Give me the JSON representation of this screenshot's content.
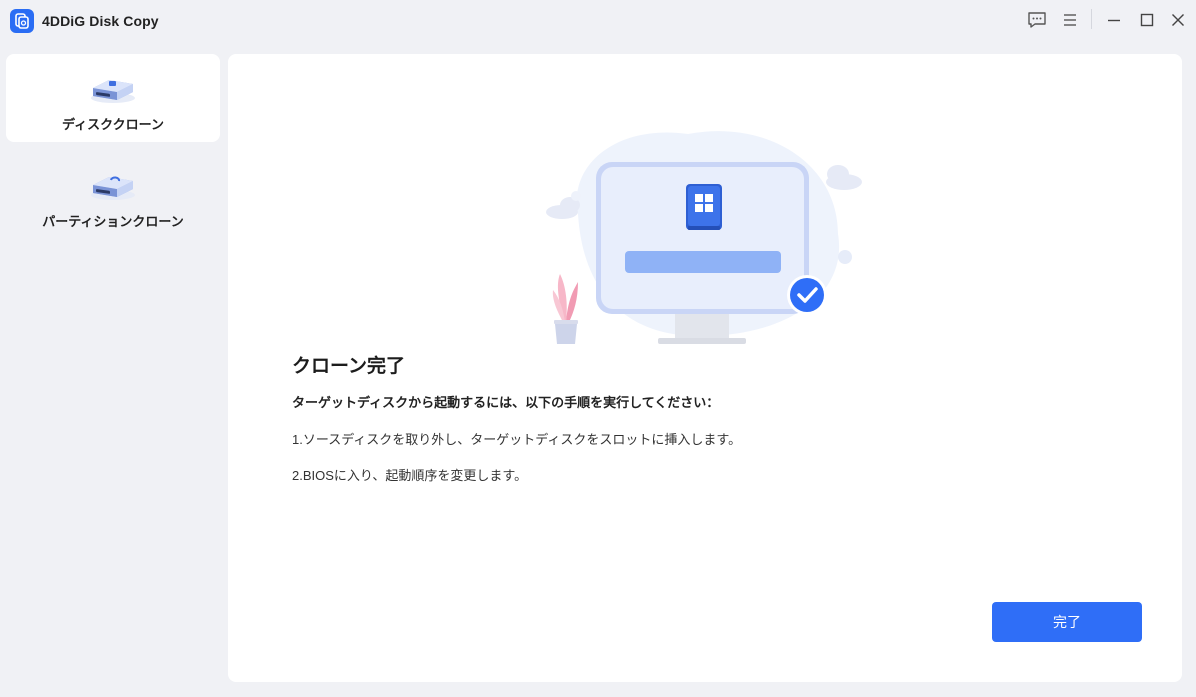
{
  "app": {
    "title": "4DDiG Disk Copy",
    "accent": "#2f6ef7"
  },
  "titlebar": {
    "icons": [
      "feedback-icon",
      "menu-icon",
      "minimize-icon",
      "maximize-icon",
      "close-icon"
    ]
  },
  "sidebar": {
    "items": [
      {
        "label": "ディスククローン",
        "icon": "disk-clone-icon",
        "active": true
      },
      {
        "label": "パーティションクローン",
        "icon": "partition-clone-icon",
        "active": false
      }
    ]
  },
  "main": {
    "title": "クローン完了",
    "subtitle": "ターゲットディスクから起動するには、以下の手順を実行してください：",
    "steps": [
      "1.ソースディスクを取り外し、ターゲットディスクをスロットに挿入します。",
      "2.BIOSに入り、起動順序を変更します。"
    ],
    "done_label": "完了"
  }
}
